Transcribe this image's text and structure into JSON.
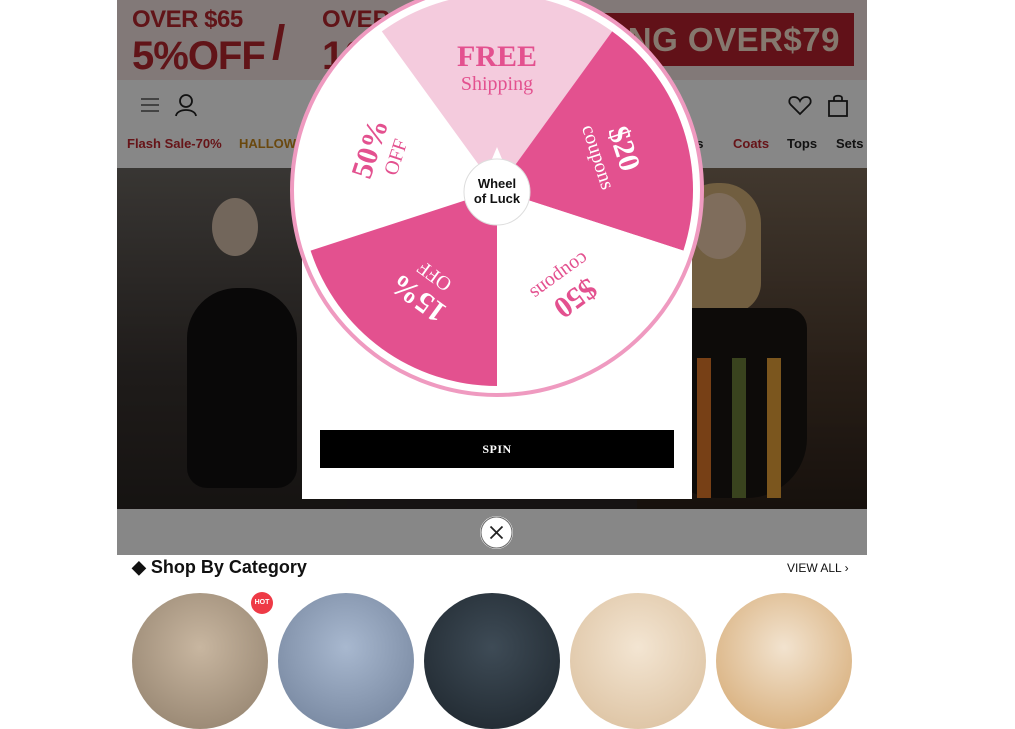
{
  "promo": {
    "left_line1": "OVER $65",
    "left_line2": "5%OFF",
    "mid_line1": "OVER $",
    "mid_line2": "10",
    "right_text": "PPING OVER$79"
  },
  "nav": {
    "items": [
      "Flash Sale-70%",
      "HALLOWE",
      "es",
      "Coats",
      "Tops",
      "Sets"
    ]
  },
  "wheel": {
    "center": [
      "Wheel",
      "of Luck"
    ],
    "segments": [
      {
        "big": "50%",
        "small": "OFF"
      },
      {
        "big": "FREE",
        "small": "Shipping"
      },
      {
        "big": "$20",
        "small": "coupons"
      },
      {
        "big": "$50",
        "small": "coupons"
      },
      {
        "big": "15%",
        "small": "OFF"
      }
    ]
  },
  "spin_label": "SPIN",
  "category": {
    "title": "Shop By Category",
    "view_all": "VIEW ALL",
    "hot_badge": "HOT"
  },
  "colors": {
    "pink_dark": "#e3518f",
    "pink_light": "#f4cbdd",
    "brand_red": "#b8262e"
  }
}
